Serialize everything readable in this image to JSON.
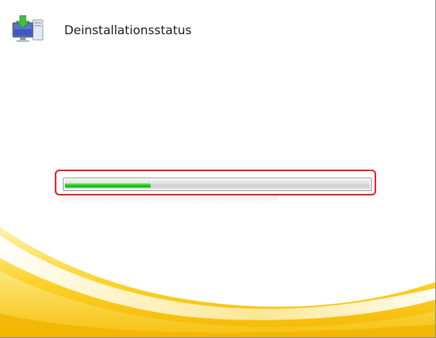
{
  "window": {
    "title": "Deinstallationsstatus",
    "icon": "computer-install-icon"
  },
  "progress": {
    "value": 0.28,
    "percent": 28,
    "highlighted": true
  },
  "colors": {
    "accent_yellow": "#f9c414",
    "progress_green": "#13c313",
    "highlight_red": "#e8141e"
  }
}
